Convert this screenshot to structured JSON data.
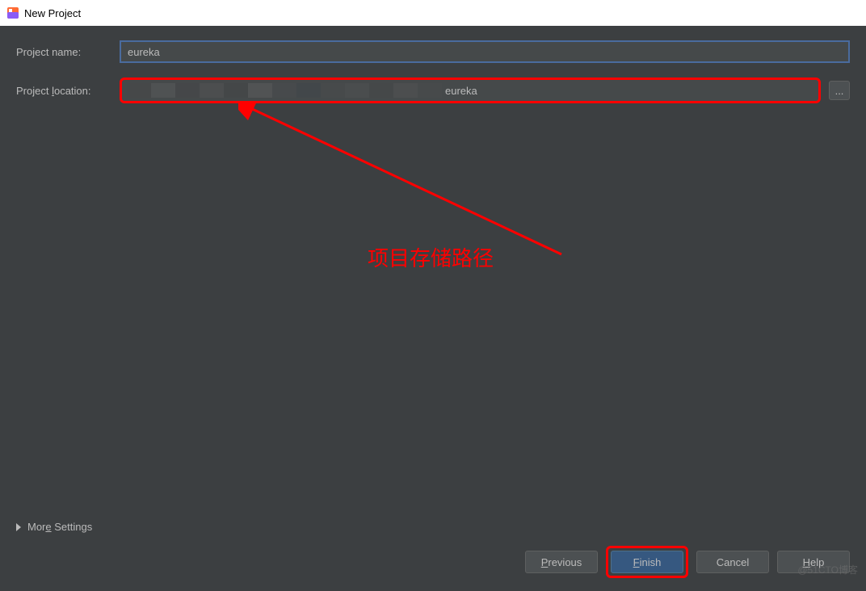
{
  "window": {
    "title": "New Project"
  },
  "form": {
    "name_label": "Project name:",
    "name_value": "eureka",
    "location_label_pre": "Project ",
    "location_label_u": "l",
    "location_label_post": "ocation:",
    "location_suffix": "eureka",
    "browse_label": "..."
  },
  "annotation": {
    "text": "项目存储路径"
  },
  "more_settings": {
    "pre": "Mor",
    "u": "e",
    "post": " Settings"
  },
  "buttons": {
    "previous_u": "P",
    "previous_post": "revious",
    "finish_u": "F",
    "finish_post": "inish",
    "cancel": "Cancel",
    "help_u": "H",
    "help_post": "elp"
  },
  "watermark": "@51CTO博客"
}
